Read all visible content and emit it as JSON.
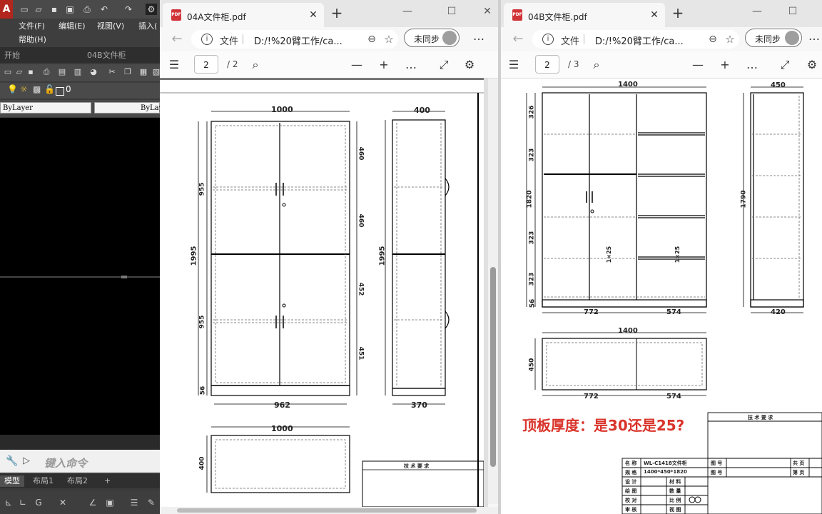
{
  "cad": {
    "qat_icons": [
      "new-icon",
      "open-icon",
      "save-icon",
      "saveas-icon",
      "print-icon",
      "undo-icon",
      "redo-icon",
      "workspace-gear-icon"
    ],
    "menu": [
      "文件(F)",
      "编辑(E)",
      "视图(V)",
      "插入("
    ],
    "menu_row2": [
      "帮助(H)"
    ],
    "file_tabs": [
      "开始",
      "04B文件柜"
    ],
    "layer_value": "0",
    "color_combo": "ByLayer",
    "linetype_combo": "ByLayer",
    "command_placeholder": "键入命令",
    "layout_tabs": [
      "模型",
      "布局1",
      "布局2",
      "+"
    ]
  },
  "left_window": {
    "tab_title": "04A文件柜.pdf",
    "address_scheme": "文件",
    "url": "D:/!%20臂工作/ca...",
    "sync_label": "未同步",
    "page_current": "2",
    "page_total": "/ 2",
    "drawing": {
      "front_width": "1000",
      "front_height": "1995",
      "front_segments": [
        "955",
        "955",
        "56"
      ],
      "right_segments": [
        "460",
        "460",
        "452",
        "451"
      ],
      "inner_width": "962",
      "side_depth_top": "400",
      "side_height": "1995",
      "side_depth_bottom": "370",
      "plan_width": "1000",
      "plan_depth": "400",
      "tech_requirements": "技 术 要 求"
    }
  },
  "right_window": {
    "tab_title": "04B文件柜.pdf",
    "address_scheme": "文件",
    "url": "D:/!%20臂工作/ca...",
    "sync_label": "未同步",
    "page_current": "2",
    "page_total": "/ 3",
    "drawing": {
      "front_width": "1400",
      "left_segments": [
        "326",
        "323",
        "1820",
        "323",
        "323",
        "56"
      ],
      "left_total": "1820",
      "shelf_note": "1×25",
      "bottom_dims": [
        "772",
        "574"
      ],
      "side_width_top": "450",
      "side_height": "1790",
      "side_width_bottom": "420",
      "plan_width": "1400",
      "plan_depth": "450",
      "plan_bottom_dims": [
        "772",
        "574"
      ],
      "question": "顶板厚度：是30还是25?",
      "tech_requirements": "技 术 要 求",
      "title_block": {
        "name_label": "名 称",
        "name_value": "WL-C1418文件柜",
        "spec_label": "规 格",
        "spec_value": "1400*450*1820",
        "rows": [
          "设 计",
          "绘 图",
          "校 对",
          "审 核"
        ],
        "mid_labels": [
          "材 料",
          "数 量",
          "比 例",
          "视 图"
        ],
        "right_labels": [
          "图 号",
          "图 号"
        ],
        "far_labels": [
          "共 页",
          "第 页"
        ]
      }
    }
  }
}
